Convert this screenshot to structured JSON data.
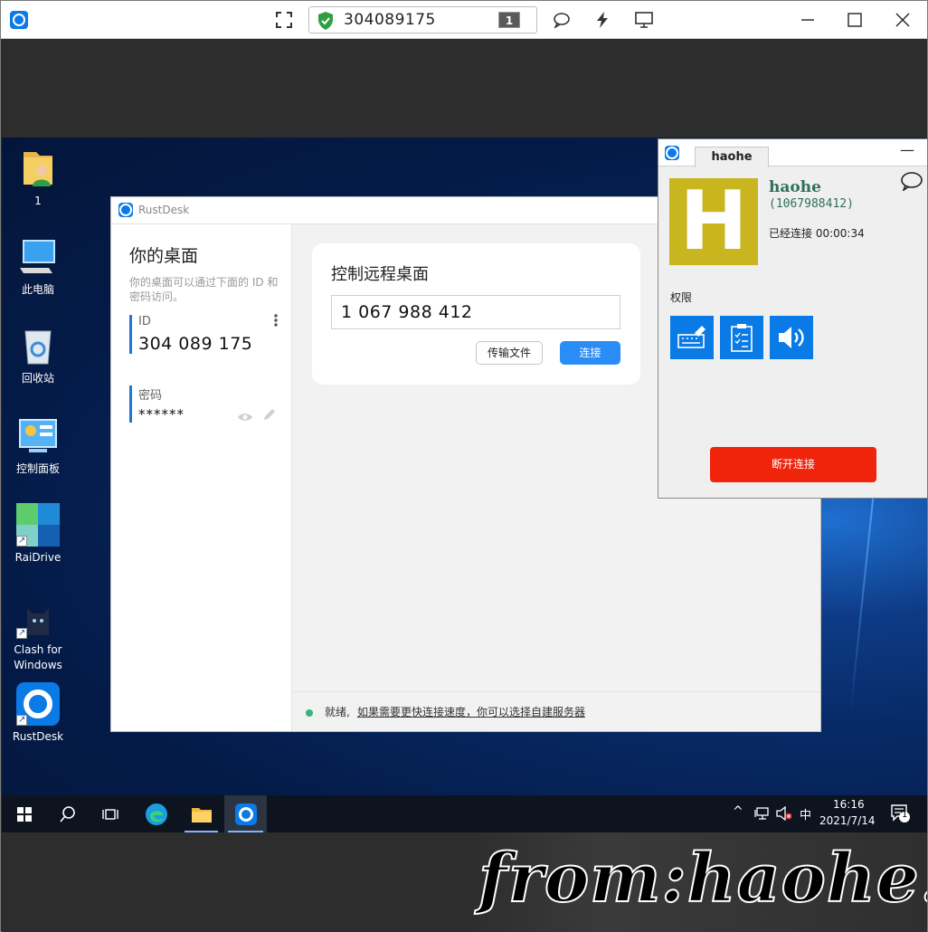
{
  "viewer": {
    "remote_id": "304089175",
    "monitor_number": "1"
  },
  "desktop_icons": [
    {
      "label": "1"
    },
    {
      "label": "此电脑"
    },
    {
      "label": "回收站"
    },
    {
      "label": "控制面板"
    },
    {
      "label": "RaiDrive"
    },
    {
      "label": "Clash for Windows"
    },
    {
      "label": "RustDesk"
    }
  ],
  "rustdesk": {
    "window_title": "RustDesk",
    "your_desktop_title": "你的桌面",
    "your_desktop_desc": "你的桌面可以通过下面的 ID 和密码访问。",
    "id_label": "ID",
    "id_value": "304 089 175",
    "password_label": "密码",
    "password_value": "******",
    "control_title": "控制远程桌面",
    "remote_id_input": "1 067 988 412",
    "transfer_file_label": "传输文件",
    "connect_label": "连接",
    "status_ready": "就绪,",
    "status_link": "如果需要更快连接速度，你可以选择自建服务器"
  },
  "connection_manager": {
    "tab_label": "haohe",
    "avatar_letter": "H",
    "avatar_color": "#c9b51e",
    "name": "haohe",
    "id": "(1067988412)",
    "connected_text": "已经连接 00:00:34",
    "permissions_label": "权限",
    "permission_icons": [
      "keyboard-icon",
      "clipboard-icon",
      "speaker-icon"
    ],
    "disconnect_label": "断开连接",
    "disconnect_color": "#f0230b"
  },
  "taskbar": {
    "ime": "中",
    "time": "16:16",
    "date": "2021/7/14",
    "notification_count": "1"
  },
  "watermark": "from:haohe.fun",
  "colors": {
    "accent": "#0a7ae6",
    "connect_button": "#2a8df5",
    "status_dot": "#36b37e",
    "name_text": "#2e6f5a"
  }
}
